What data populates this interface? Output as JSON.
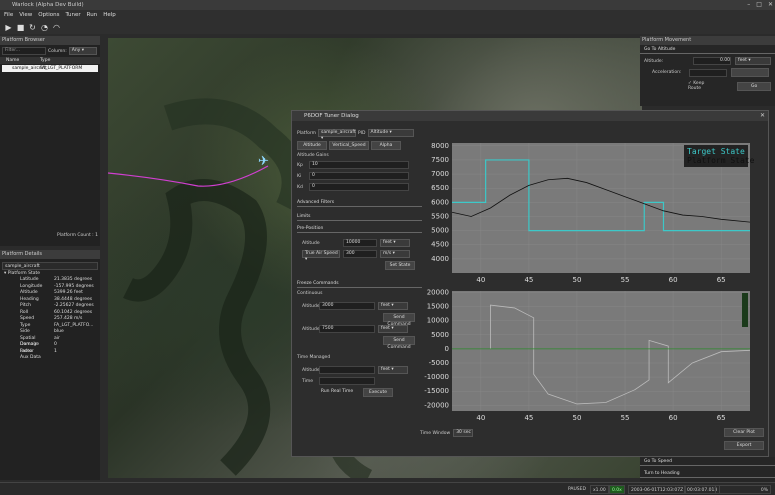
{
  "window": {
    "title": "Warlock (Alpha Dev Build)"
  },
  "menu": [
    "File",
    "View",
    "Options",
    "Tuner",
    "Run",
    "Help"
  ],
  "platform_browser": {
    "title": "Platform Browser",
    "filter_placeholder": "Filter...",
    "column_label": "Column:",
    "column_value": "Any",
    "headers": [
      "Name",
      "Type"
    ],
    "rows": [
      {
        "name": "sample_aircraft",
        "type": "FA_LGT_PLATFORM"
      }
    ],
    "count_label": "Platform Count : 1"
  },
  "platform_details": {
    "title": "Platform Details",
    "name": "sample_aircraft",
    "group": "Platform State",
    "fields": [
      {
        "k": "Latitude",
        "v": "21.3835 degrees"
      },
      {
        "k": "Longitude",
        "v": "-157.995 degrees"
      },
      {
        "k": "Altitude",
        "v": "5399.26 feet"
      },
      {
        "k": "Heading",
        "v": "38.4448 degrees"
      },
      {
        "k": "Pitch",
        "v": "-2.25627 degrees"
      },
      {
        "k": "Roll",
        "v": "60.1042 degrees"
      },
      {
        "k": "Speed",
        "v": "257.428 m/s"
      },
      {
        "k": "Type",
        "v": "FA_LGT_PLATFO..."
      },
      {
        "k": "Side",
        "v": "blue"
      },
      {
        "k": "Spatial Domain",
        "v": "air"
      },
      {
        "k": "Damage Factor",
        "v": "0"
      },
      {
        "k": "Index",
        "v": "1"
      },
      {
        "k": "Aux Data",
        "v": ""
      }
    ]
  },
  "platform_movement": {
    "title": "Platform Movement",
    "goto_altitude": "Go To Altitude",
    "altitude_label": "Altitude:",
    "altitude_value": "0.00",
    "altitude_unit": "feet",
    "accel_label": "Acceleration:",
    "keep_route": "Keep Route",
    "go": "Go",
    "goto_speed": "Go To Speed",
    "turn_heading": "Turn to Heading"
  },
  "dialog": {
    "title": "P6DOF Tuner Dialog",
    "platform_label": "Platform",
    "platform_value": "sample_aircraft",
    "pid_label": "PID",
    "pid_value": "Altitude",
    "tabs": [
      "Altitude",
      "Vertical_Speed",
      "Alpha"
    ],
    "gains_label": "Altitude Gains",
    "kp_label": "Kp",
    "kp": "10",
    "ki_label": "Ki",
    "ki": "0",
    "kd_label": "Kd",
    "kd": "0",
    "advanced": "Advanced Filters",
    "limits": "Limits",
    "preposition": "Pre-Position",
    "pp_alt_label": "Altitude",
    "pp_alt": "10000",
    "pp_alt_unit": "feet",
    "pp_speed_label": "True Air Speed",
    "pp_speed": "300",
    "pp_speed_unit": "m/s",
    "set_state": "Set State",
    "freeze": "Freeze Commands",
    "continuous": "Continuous",
    "c_alt_label": "Altitude",
    "c_alt": "3000",
    "c_alt_unit": "feet",
    "send1": "Send Command",
    "c_alt2_label": "Altitude",
    "c_alt2": "7500",
    "c_alt2_unit": "feet",
    "send2": "Send Command",
    "time_managed": "Time Managed",
    "tm_alt_label": "Altitude",
    "tm_alt_unit": "feet",
    "tm_time_label": "Time",
    "run_real": "Run Real Time",
    "execute": "Execute",
    "time_window_label": "Time Window",
    "time_window": "30 sec",
    "clear_plot": "Clear Plot",
    "export": "Export"
  },
  "chart_data": [
    {
      "type": "line",
      "xlim": [
        37,
        68
      ],
      "ylim": [
        3500,
        8100
      ],
      "xticks": [
        40,
        45,
        50,
        55,
        60,
        65
      ],
      "yticks": [
        4000,
        4500,
        5000,
        5500,
        6000,
        6500,
        7000,
        7500,
        8000
      ],
      "legend": [
        "Target State",
        "Platform State"
      ],
      "series": [
        {
          "name": "Target State",
          "color": "#3cc8c8",
          "x": [
            37,
            40.5,
            40.5,
            45,
            45,
            57,
            57,
            59,
            59,
            68
          ],
          "values": [
            6000,
            6000,
            7500,
            7500,
            5000,
            5000,
            6000,
            6000,
            5000,
            5000
          ]
        },
        {
          "name": "Platform State",
          "color": "#111111",
          "x": [
            37,
            39,
            41,
            43,
            45,
            47,
            49,
            51,
            53,
            55,
            57,
            59,
            61,
            63,
            65,
            68
          ],
          "values": [
            5650,
            5500,
            5800,
            6250,
            6600,
            6800,
            6850,
            6700,
            6450,
            6200,
            5950,
            5700,
            5550,
            5500,
            5400,
            5300
          ]
        }
      ]
    },
    {
      "type": "line",
      "xlim": [
        37,
        68
      ],
      "ylim": [
        -22000,
        20500
      ],
      "xticks": [
        40,
        45,
        50,
        55,
        60,
        65
      ],
      "yticks": [
        -20000,
        -15000,
        -10000,
        -5000,
        0,
        5000,
        10000,
        15000,
        20000
      ],
      "series": [
        {
          "color": "#bbbbbb",
          "x": [
            41,
            41,
            43.5,
            45.5,
            45.5,
            47,
            50,
            53,
            56,
            57.5,
            57.5,
            59.5,
            59.5,
            62,
            65,
            68
          ],
          "values": [
            0,
            15500,
            14500,
            11000,
            -9000,
            -16000,
            -19500,
            -19000,
            -14500,
            -11000,
            3000,
            1000,
            -12000,
            -5000,
            -1000,
            -500
          ]
        },
        {
          "color": "#2a8a2a",
          "x": [
            37,
            68
          ],
          "values": [
            0,
            0
          ]
        }
      ]
    }
  ],
  "status": {
    "state": "PAUSED",
    "speed": "x1.00",
    "sim": "0.0x",
    "datetime": "2003-06-01T12:03:07Z",
    "elapsed": "00:03:07.013",
    "pct": "0%"
  }
}
